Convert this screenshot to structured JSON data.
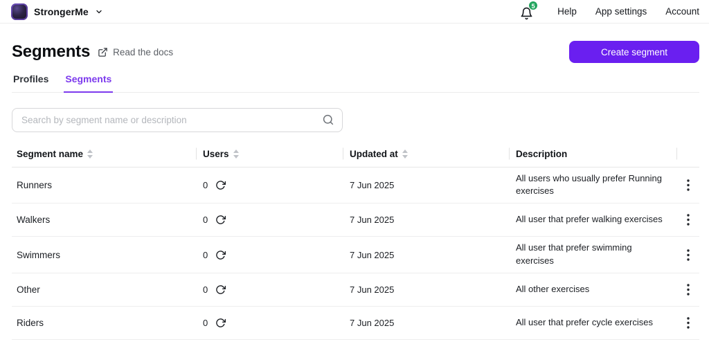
{
  "header": {
    "app_name": "StrongerMe",
    "notification_count": "5",
    "nav_items": [
      "Help",
      "App settings",
      "Account"
    ]
  },
  "page": {
    "title": "Segments",
    "docs_link": "Read the docs",
    "create_button": "Create segment"
  },
  "tabs": [
    {
      "label": "Profiles",
      "active": false
    },
    {
      "label": "Segments",
      "active": true
    }
  ],
  "search": {
    "placeholder": "Search by segment name or description"
  },
  "table": {
    "columns": [
      "Segment name",
      "Users",
      "Updated at",
      "Description"
    ],
    "rows": [
      {
        "name": "Runners",
        "users": "0",
        "updated": "7 Jun 2025",
        "description": "All users who usually prefer Running exercises"
      },
      {
        "name": "Walkers",
        "users": "0",
        "updated": "7 Jun 2025",
        "description": "All user that prefer walking exercises"
      },
      {
        "name": "Swimmers",
        "users": "0",
        "updated": "7 Jun 2025",
        "description": "All user that prefer swimming exercises"
      },
      {
        "name": "Other",
        "users": "0",
        "updated": "7 Jun 2025",
        "description": "All other exercises"
      },
      {
        "name": "Riders",
        "users": "0",
        "updated": "7 Jun 2025",
        "description": "All user that prefer cycle exercises"
      }
    ]
  },
  "colors": {
    "accent": "#6a1ff0",
    "tab_accent": "#7c3aed",
    "badge_green": "#23a55e"
  }
}
